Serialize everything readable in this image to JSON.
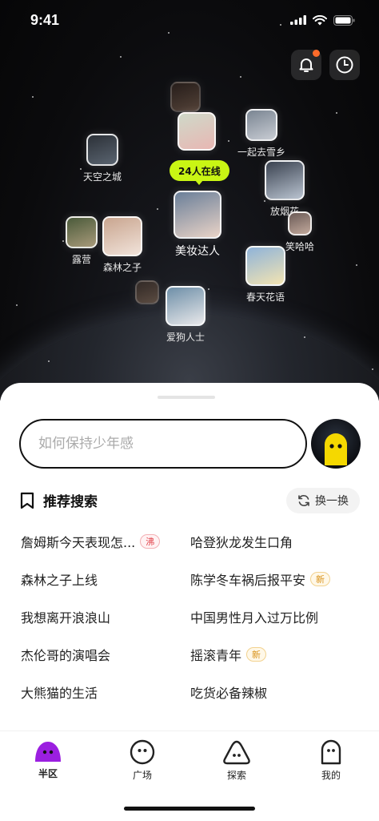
{
  "status_bar": {
    "time": "9:41"
  },
  "galaxy": {
    "online_badge": "24人在线",
    "nodes": [
      {
        "label": "",
        "colors": [
          "#3b2a22",
          "#8a6a55"
        ]
      },
      {
        "label": "",
        "colors": [
          "#cfd9c9",
          "#e8b7b3"
        ]
      },
      {
        "label": "一起去雪乡",
        "colors": [
          "#7a8592",
          "#c8ccd3"
        ]
      },
      {
        "label": "天空之城",
        "colors": [
          "#2c3138",
          "#5a6470"
        ]
      },
      {
        "label": "放烟花",
        "colors": [
          "#3a4250",
          "#b9c3d0"
        ]
      },
      {
        "label": "美妆达人",
        "colors": [
          "#6a7f99",
          "#e9d3c7"
        ]
      },
      {
        "label": "笑哈哈",
        "colors": [
          "#6b5b57",
          "#c2a99c"
        ]
      },
      {
        "label": "露营",
        "colors": [
          "#4a5a3a",
          "#a89a7a"
        ]
      },
      {
        "label": "森林之子",
        "colors": [
          "#c9a58f",
          "#f1e3da"
        ]
      },
      {
        "label": "春天花语",
        "colors": [
          "#8fb3d9",
          "#f3e4b2"
        ]
      },
      {
        "label": "",
        "colors": [
          "#4a3a30",
          "#8e7058"
        ]
      },
      {
        "label": "爱狗人士",
        "colors": [
          "#6e8fa8",
          "#e8e8ea"
        ]
      }
    ]
  },
  "search": {
    "placeholder": "如何保持少年感"
  },
  "recommend": {
    "title": "推荐搜索",
    "refresh_label": "换一换",
    "items": [
      {
        "text": "詹姆斯今天表现怎...",
        "tag": "沸",
        "tag_type": "hot"
      },
      {
        "text": "哈登狄龙发生口角",
        "tag": "",
        "tag_type": ""
      },
      {
        "text": "森林之子上线",
        "tag": "",
        "tag_type": ""
      },
      {
        "text": "陈学冬车祸后报平安",
        "tag": "新",
        "tag_type": "new"
      },
      {
        "text": "我想离开浪浪山",
        "tag": "",
        "tag_type": ""
      },
      {
        "text": "中国男性月入过万比例",
        "tag": "",
        "tag_type": ""
      },
      {
        "text": "杰伦哥的演唱会",
        "tag": "",
        "tag_type": ""
      },
      {
        "text": "摇滚青年",
        "tag": "新",
        "tag_type": "new"
      },
      {
        "text": "大熊猫的生活",
        "tag": "",
        "tag_type": ""
      },
      {
        "text": "吃货必备辣椒",
        "tag": "",
        "tag_type": ""
      }
    ]
  },
  "tabs": [
    {
      "label": "半区",
      "icon": "ghost-filled-icon",
      "active": true
    },
    {
      "label": "广场",
      "icon": "face-circle-icon",
      "active": false
    },
    {
      "label": "探索",
      "icon": "triangle-ghost-icon",
      "active": false
    },
    {
      "label": "我的",
      "icon": "capsule-ghost-icon",
      "active": false
    }
  ],
  "colors": {
    "accent_lime": "#c9f514",
    "tab_active": "#9b1fe0",
    "hot_tag": "#e2474f",
    "new_tag": "#d9921a"
  }
}
